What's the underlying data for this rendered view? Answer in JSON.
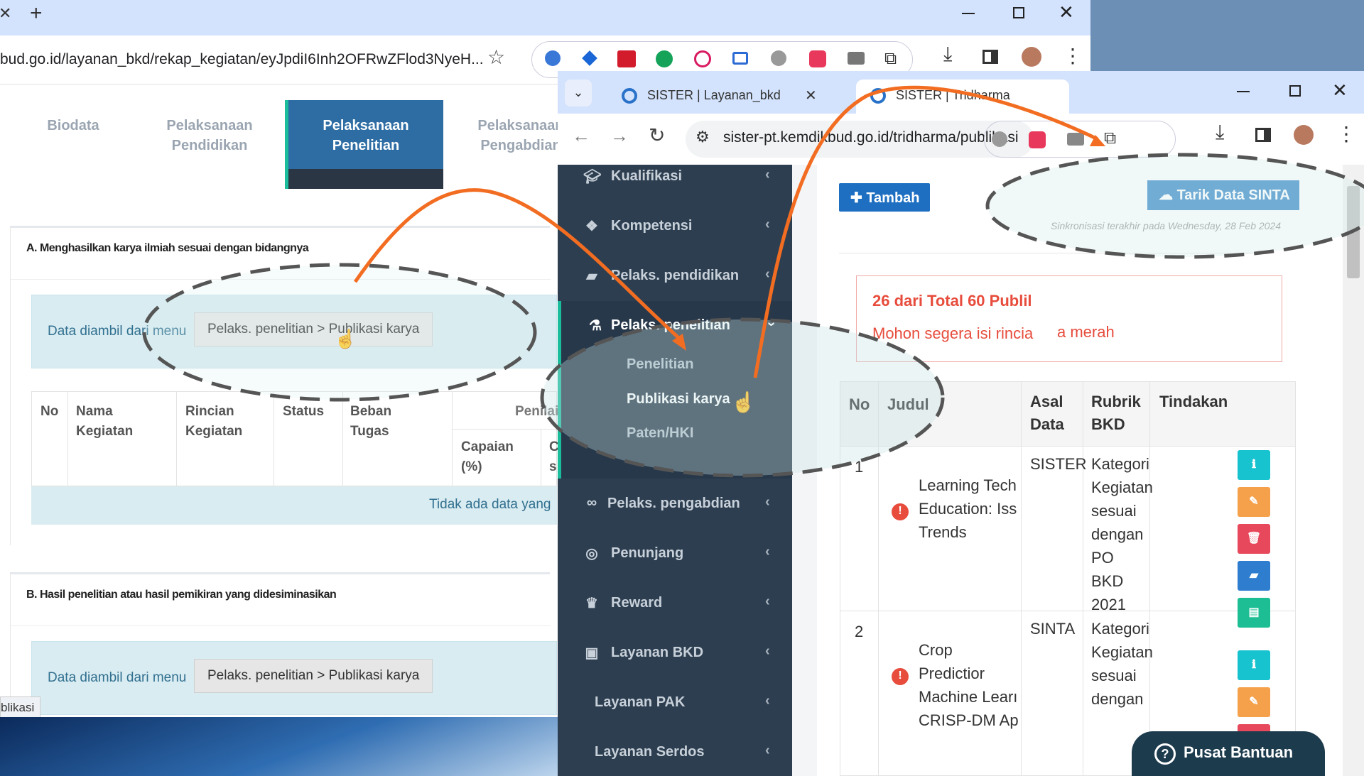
{
  "browser_back": {
    "url": "bud.go.id/layanan_bkd/rekap_kegiatan/eyJpdiI6Inh2OFRwZFlod3NyeH...",
    "status_text": "blikasi"
  },
  "nav_tabs": [
    {
      "label": "Biodata"
    },
    {
      "label": "Pelaksanaan Pendidikan"
    },
    {
      "label": "Pelaksanaan Penelitian"
    },
    {
      "label": "Pelaksanaan Pengabdian"
    }
  ],
  "section_a": {
    "title": "A. Menghasilkan karya ilmiah sesuai dengan bidangnya",
    "info_prefix": "Data diambil dari menu",
    "info_path": "Pelaks. penelitian > Publikasi karya",
    "headers": {
      "no": "No",
      "nama": "Nama Kegiatan",
      "rincian": "Rincian Kegiatan",
      "status": "Status",
      "beban": "Beban Tugas",
      "penilaian": "Penilai",
      "capaian": "Capaian (%)",
      "extra": "C s"
    },
    "empty_text": "Tidak ada data yang"
  },
  "section_b": {
    "title": "B. Hasil penelitian atau hasil pemikiran yang didesiminasikan",
    "info_prefix": "Data diambil dari menu",
    "info_path": "Pelaks. penelitian > Publikasi karya"
  },
  "browser_front": {
    "tabs": [
      {
        "title": "SISTER | Layanan_bkd"
      },
      {
        "title": "SISTER | Tridharma"
      }
    ],
    "url": "sister-pt.kemdikbud.go.id/tridharma/publikasi"
  },
  "sidebar": {
    "items": [
      {
        "label": "Kualifikasi",
        "icon": "graduation-cap-icon"
      },
      {
        "label": "Kompetensi",
        "icon": "cubes-icon"
      },
      {
        "label": "Pelaks. pendidikan",
        "icon": "book-icon"
      },
      {
        "label": "Pelaks. penelitian",
        "icon": "flask-icon"
      },
      {
        "label": "Pelaks. pengabdian",
        "icon": "link-icon"
      },
      {
        "label": "Penunjang",
        "icon": "life-ring-icon"
      },
      {
        "label": "Reward",
        "icon": "trophy-icon"
      },
      {
        "label": "Layanan BKD",
        "icon": "briefcase-icon"
      },
      {
        "label": "Layanan PAK",
        "icon": ""
      },
      {
        "label": "Layanan Serdos",
        "icon": ""
      }
    ],
    "submenu": [
      {
        "label": "Penelitian"
      },
      {
        "label": "Publikasi karya"
      },
      {
        "label": "Paten/HKI"
      }
    ]
  },
  "content": {
    "add_button": "Tambah",
    "sync_button": "Tarik Data SINTA",
    "sync_note": "Sinkronisasi terakhir pada Wednesday, 28 Feb 2024",
    "alert_title": "26 dari Total 60 Publil",
    "alert_text": "Mohon segera isi rincia",
    "alert_text_tail": "a merah",
    "table_headers": {
      "no": "No",
      "judul": "Judul",
      "asal": "Asal Data",
      "rubrik": "Rubrik BKD",
      "tindakan": "Tindakan"
    },
    "rows": [
      {
        "no": "1",
        "judul": "Learning Tech Education: Iss Trends",
        "asal": "SISTER",
        "rubrik": "Kategori Kegiatan sesuai dengan PO BKD 2021"
      },
      {
        "no": "2",
        "judul": "Crop Predictior Machine Learı CRISP-DM Ap",
        "asal": "SINTA",
        "rubrik": "Kategori Kegiatan sesuai dengan"
      }
    ],
    "help_button": "Pusat Bantuan"
  },
  "colors": {
    "accent_orange": "#f26d21",
    "sidebar_bg": "#2c3e50",
    "primary_blue": "#1e6fc1",
    "btn_teal": "#17c3cf",
    "btn_orange": "#f5a04b",
    "btn_red": "#e8485c",
    "btn_blue": "#2e7dcf",
    "btn_green": "#1dbe93"
  }
}
